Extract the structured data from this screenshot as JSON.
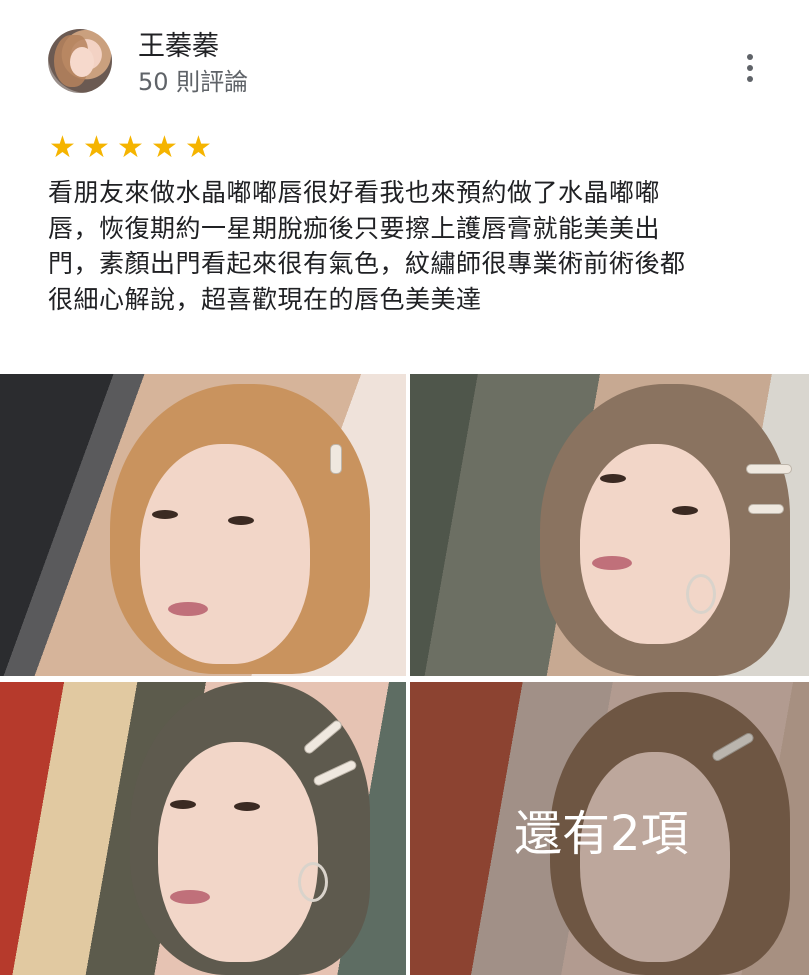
{
  "user": {
    "name": "王蓁蓁",
    "review_count": "50 則評論"
  },
  "rating": {
    "stars": 5,
    "star_glyph": "★",
    "star_color": "#f5b400"
  },
  "review": {
    "lines": [
      "看朋友來做水晶嘟嘟唇很好看我也來預約做了水晶嘟嘟",
      "唇，恢復期約一星期脫痂後只要擦上護唇膏就能美美出",
      "門，素顏出門看起來很有氣色，紋繡師很專業術前術後都",
      "很細心解說，超喜歡現在的唇色美美達"
    ]
  },
  "gallery": {
    "more_label": "還有2項"
  },
  "icons": {
    "more": "more-vert-icon"
  }
}
